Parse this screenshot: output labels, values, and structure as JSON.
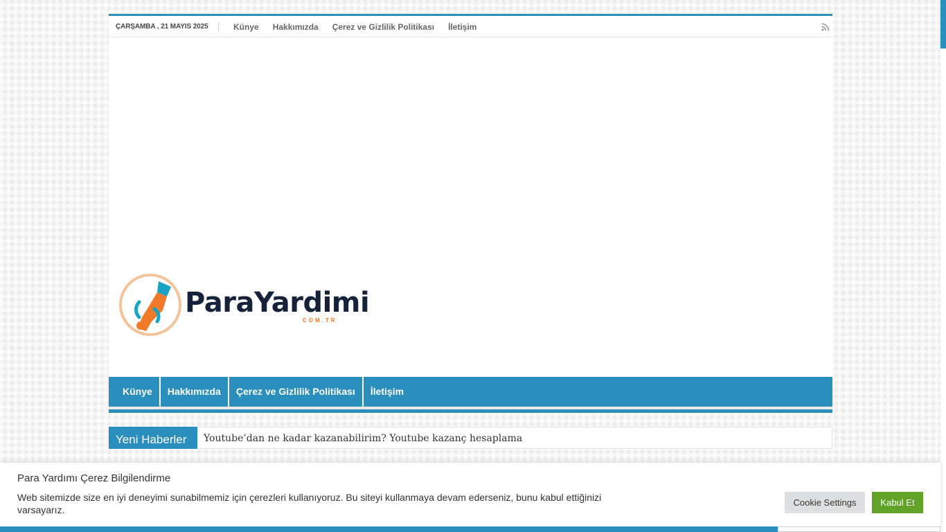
{
  "topbar": {
    "date": "ÇARŞAMBA , 21 MAYIS 2025",
    "links": [
      "Künye",
      "Hakkımızda",
      "Çerez ve Gizlilik Politikası",
      "İletişim"
    ],
    "rss_icon": "rss-icon"
  },
  "logo": {
    "text": "ParaYardimi",
    "sub": "COM.TR"
  },
  "mainnav": {
    "items": [
      "Künye",
      "Hakkımızda",
      "Çerez ve Gizlilik Politikası",
      "İletişim"
    ]
  },
  "ticker": {
    "label": "Yeni Haberler",
    "headline": "Youtube’dan ne kadar kazanabilirim? Youtube kazanç hesaplama"
  },
  "cookie": {
    "title": "Para Yardımı Çerez Bilgilendirme",
    "message": "Web sitemizde size en iyi deneyimi sunabilmemiz için çerezleri kullanıyoruz. Bu siteyi kullanmaya devam ederseniz, bunu kabul ettiğinizi varsayarız.",
    "settings_label": "Cookie Settings",
    "accept_label": "Kabul Et"
  },
  "colors": {
    "accent": "#2a8fbd",
    "accept": "#61a229",
    "logo_orange": "#f07a2a",
    "logo_dark": "#16223a"
  }
}
